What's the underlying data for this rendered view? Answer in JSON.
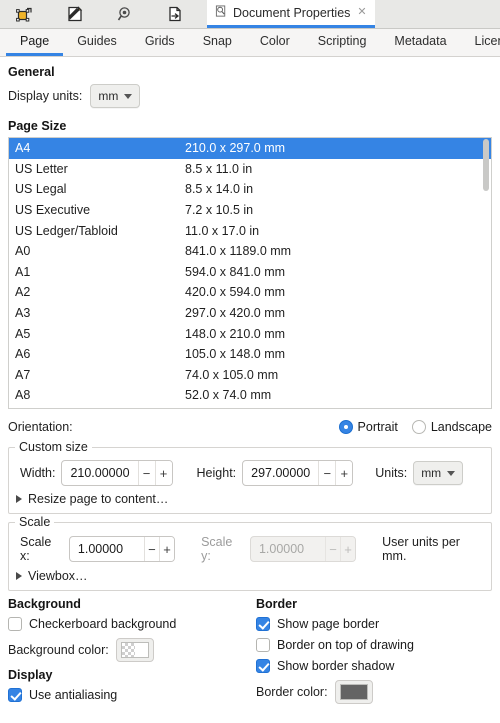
{
  "window": {
    "toolbar_icons": [
      "edit-objects-icon",
      "pencil-page-icon",
      "snap-magnifier-icon",
      "export-page-icon"
    ],
    "doc_tab": {
      "icon": "document-properties-icon",
      "label": "Document Properties",
      "close": "✕"
    }
  },
  "tabs": [
    {
      "label": "Page",
      "active": true
    },
    {
      "label": "Guides",
      "active": false
    },
    {
      "label": "Grids",
      "active": false
    },
    {
      "label": "Snap",
      "active": false
    },
    {
      "label": "Color",
      "active": false
    },
    {
      "label": "Scripting",
      "active": false
    },
    {
      "label": "Metadata",
      "active": false
    },
    {
      "label": "License",
      "active": false
    }
  ],
  "general": {
    "title": "General",
    "display_units_label": "Display units:",
    "display_units_value": "mm"
  },
  "page_size": {
    "title": "Page Size",
    "selected_index": 0,
    "rows": [
      {
        "name": "A4",
        "dim": "210.0 x 297.0 mm"
      },
      {
        "name": "US Letter",
        "dim": "8.5 x 11.0 in"
      },
      {
        "name": "US Legal",
        "dim": "8.5 x 14.0 in"
      },
      {
        "name": "US Executive",
        "dim": "7.2 x 10.5 in"
      },
      {
        "name": "US Ledger/Tabloid",
        "dim": "11.0 x 17.0 in"
      },
      {
        "name": "A0",
        "dim": "841.0 x 1189.0 mm"
      },
      {
        "name": "A1",
        "dim": "594.0 x 841.0 mm"
      },
      {
        "name": "A2",
        "dim": "420.0 x 594.0 mm"
      },
      {
        "name": "A3",
        "dim": "297.0 x 420.0 mm"
      },
      {
        "name": "A5",
        "dim": "148.0 x 210.0 mm"
      },
      {
        "name": "A6",
        "dim": "105.0 x 148.0 mm"
      },
      {
        "name": "A7",
        "dim": "74.0 x 105.0 mm"
      },
      {
        "name": "A8",
        "dim": "52.0 x 74.0 mm"
      }
    ]
  },
  "orientation": {
    "label": "Orientation:",
    "portrait_label": "Portrait",
    "landscape_label": "Landscape",
    "selected": "Portrait"
  },
  "custom_size": {
    "title": "Custom size",
    "width_label": "Width:",
    "width_value": "210.00000",
    "height_label": "Height:",
    "height_value": "297.00000",
    "units_label": "Units:",
    "units_value": "mm",
    "minus": "−",
    "plus": "+",
    "resize_expander": "Resize page to content…"
  },
  "scale": {
    "title": "Scale",
    "scale_x_label": "Scale x:",
    "scale_x_value": "1.00000",
    "scale_y_label": "Scale y:",
    "scale_y_value": "1.00000",
    "units_note": "User units per mm.",
    "viewbox_expander": "Viewbox…",
    "minus": "−",
    "plus": "+"
  },
  "background": {
    "title": "Background",
    "checkerboard_label": "Checkerboard background",
    "checkerboard_checked": false,
    "color_label": "Background color:",
    "color_swatch": "transparent-white"
  },
  "display": {
    "title": "Display",
    "antialias_label": "Use antialiasing",
    "antialias_checked": true
  },
  "border": {
    "title": "Border",
    "show_page_border_label": "Show page border",
    "show_page_border_checked": true,
    "border_on_top_label": "Border on top of drawing",
    "border_on_top_checked": false,
    "show_shadow_label": "Show border shadow",
    "show_shadow_checked": true,
    "color_label": "Border color:",
    "color_swatch": "#646464"
  },
  "colors": {
    "accent": "#3584e4",
    "selection_bg": "#3584e4",
    "toolbar_bg": "#e8e8e6",
    "tabbar_bg": "#f6f5f4"
  }
}
